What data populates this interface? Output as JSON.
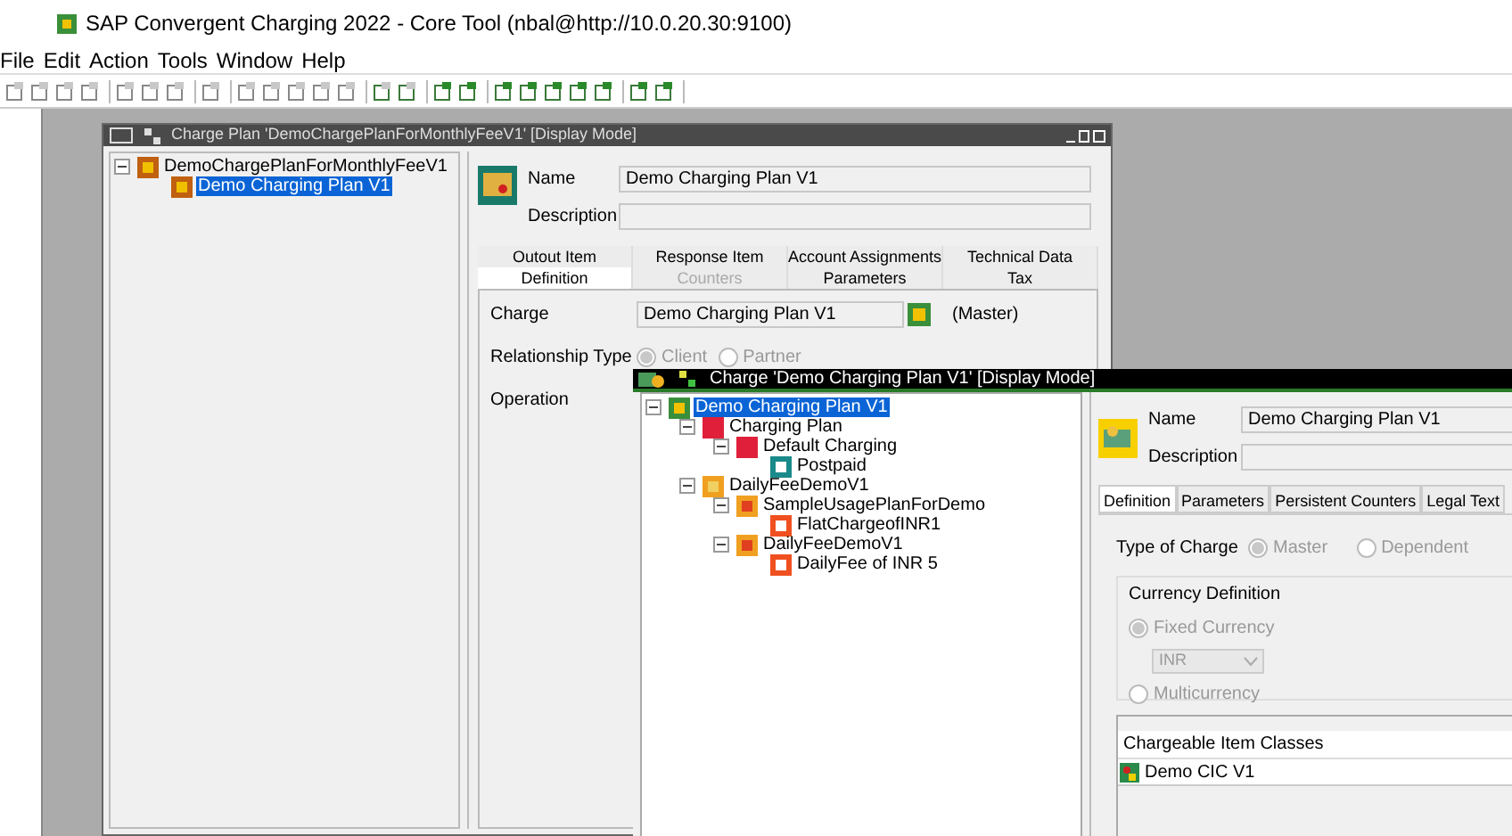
{
  "app_title": "SAP Convergent Charging 2022 - Core Tool (nbal@http://10.0.20.30:9100)",
  "menu": [
    "File",
    "Edit",
    "Action",
    "Tools",
    "Window",
    "Help"
  ],
  "plan_window": {
    "title": "Charge Plan 'DemoChargePlanForMonthlyFeeV1' [Display Mode]",
    "tree": [
      {
        "label": "DemoChargePlanForMonthlyFeeV1",
        "selected": false,
        "children": [
          {
            "label": "Demo Charging Plan V1",
            "selected": true
          }
        ]
      }
    ],
    "name_label": "Name",
    "name_value": "Demo Charging Plan V1",
    "description_label": "Description",
    "tab_rows": [
      [
        {
          "label": "Outout Item",
          "selected": false,
          "disabled": false
        },
        {
          "label": "Response Item",
          "selected": false,
          "disabled": false
        },
        {
          "label": "Account Assignments",
          "selected": false,
          "disabled": false
        },
        {
          "label": "Technical Data",
          "selected": false,
          "disabled": false
        }
      ],
      [
        {
          "label": "Definition",
          "selected": true,
          "disabled": false
        },
        {
          "label": "Counters",
          "selected": false,
          "disabled": true
        },
        {
          "label": "Parameters",
          "selected": false,
          "disabled": false
        },
        {
          "label": "Tax",
          "selected": false,
          "disabled": false
        }
      ]
    ],
    "charge_label": "Charge",
    "charge_value": "Demo Charging Plan V1",
    "charge_role": "(Master)",
    "relationship_label": "Relationship Type",
    "relationship_options": [
      {
        "label": "Client",
        "selected": true
      },
      {
        "label": "Partner",
        "selected": false
      }
    ],
    "operation_label": "Operation"
  },
  "charge_window": {
    "title": "Charge 'Demo Charging Plan V1' [Display Mode]",
    "tree": [
      {
        "label": "Demo Charging Plan V1",
        "kind": "charge",
        "selected": true,
        "children": [
          {
            "label": "Charging Plan",
            "kind": "plan",
            "selected": false,
            "children": [
              {
                "label": "Default Charging",
                "kind": "plan",
                "selected": false,
                "children": [
                  {
                    "label": "Postpaid",
                    "kind": "mode",
                    "selected": false
                  }
                ]
              }
            ]
          },
          {
            "label": "DailyFeeDemoV1",
            "kind": "person",
            "selected": false,
            "children": [
              {
                "label": "SampleUsagePlanForDemo",
                "kind": "usage",
                "selected": false,
                "children": [
                  {
                    "label": "FlatChargeofINR1",
                    "kind": "fee",
                    "selected": false
                  }
                ]
              },
              {
                "label": "DailyFeeDemoV1",
                "kind": "usage",
                "selected": false,
                "children": [
                  {
                    "label": "DailyFee of INR 5",
                    "kind": "fee",
                    "selected": false
                  }
                ]
              }
            ]
          }
        ]
      }
    ],
    "name_label": "Name",
    "name_value": "Demo Charging Plan V1",
    "description_label": "Description",
    "tabs": [
      {
        "label": "Definition",
        "selected": true
      },
      {
        "label": "Parameters",
        "selected": false
      },
      {
        "label": "Persistent Counters",
        "selected": false
      },
      {
        "label": "Legal Text",
        "selected": false
      }
    ],
    "type_label": "Type of Charge",
    "type_options": [
      {
        "label": "Master",
        "selected": true
      },
      {
        "label": "Dependent",
        "selected": false
      }
    ],
    "currency_group": "Currency Definition",
    "currency_options": [
      {
        "label": "Fixed Currency",
        "selected": true
      },
      {
        "label": "Multicurrency",
        "selected": false
      }
    ],
    "currency_value": "INR",
    "table": {
      "header": "Chargeable Item Classes",
      "rows": [
        "Demo CIC V1"
      ]
    }
  }
}
